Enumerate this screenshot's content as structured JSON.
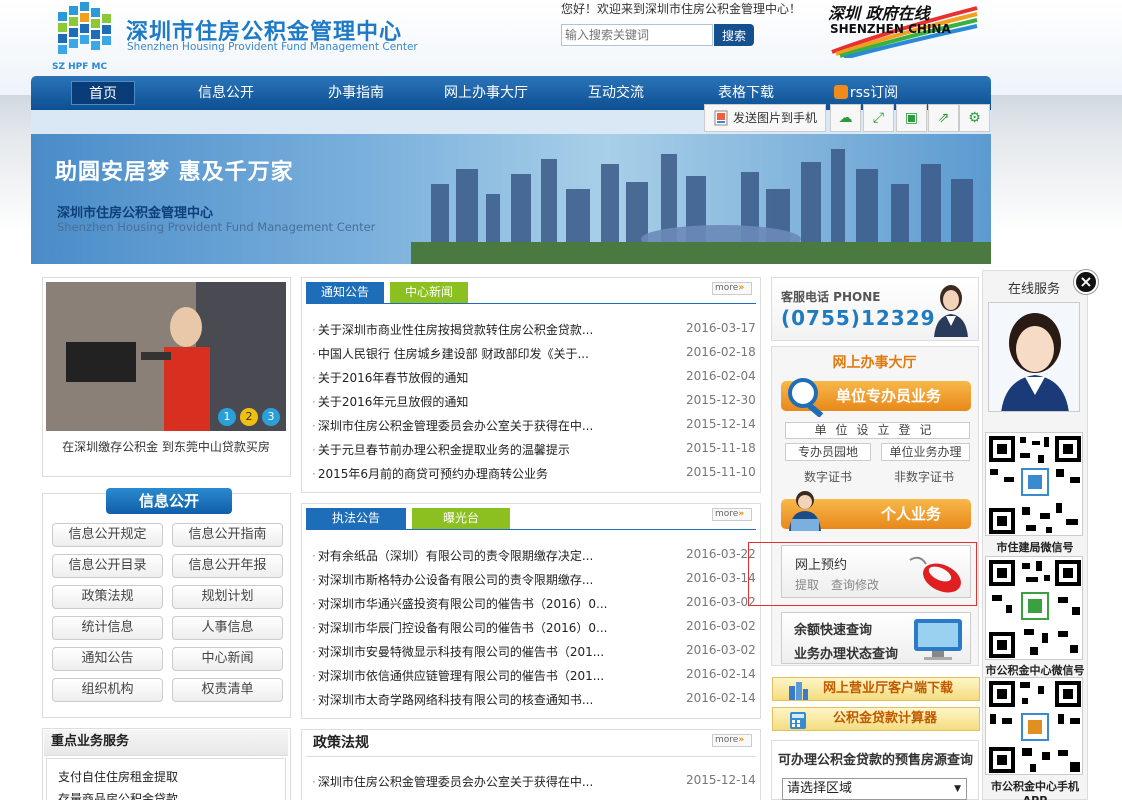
{
  "header": {
    "logo_cn": "深圳市住房公积金管理中心",
    "logo_en": "Shenzhen Housing Provident Fund Management Center",
    "logo_abbr": "SZ HPF MC",
    "welcome": "您好！欢迎来到深圳市住房公积金管理中心！",
    "search_placeholder": "输入搜索关键词",
    "search_button": "搜索",
    "gov_logo_cn": "深圳 政府在线",
    "gov_logo_en": "SHENZHEN CHINA"
  },
  "nav": {
    "items": [
      "首页",
      "信息公开",
      "办事指南",
      "网上办事大厅",
      "互动交流",
      "表格下载",
      "rss订阅"
    ]
  },
  "toolbar": {
    "send_label": "发送图片到手机",
    "icons": [
      "cloud-icon",
      "fullscreen-icon",
      "save-icon",
      "share-icon",
      "settings-icon"
    ]
  },
  "banner": {
    "slogan": "助圆安居梦 惠及千万家",
    "org_cn": "深圳市住房公积金管理中心",
    "org_en": "Shenzhen Housing Provident Fund Management Center"
  },
  "slideshow": {
    "caption": "在深圳缴存公积金 到东莞中山贷款买房",
    "dots": [
      "1",
      "2",
      "3"
    ]
  },
  "info_open": {
    "title": "信息公开",
    "buttons": [
      "信息公开规定",
      "信息公开指南",
      "信息公开目录",
      "信息公开年报",
      "政策法规",
      "规划计划",
      "统计信息",
      "人事信息",
      "通知公告",
      "中心新闻",
      "组织机构",
      "权责清单"
    ]
  },
  "key_services": {
    "title": "重点业务服务",
    "items": [
      "支付自住住房租金提取",
      "存量商品房公积金贷款"
    ]
  },
  "news1": {
    "tabs": [
      "通知公告",
      "中心新闻"
    ],
    "more": "more",
    "items": [
      {
        "title": "关于深圳市商业性住房按揭贷款转住房公积金贷款...",
        "date": "2016-03-17"
      },
      {
        "title": "中国人民银行 住房城乡建设部 财政部印发《关于...",
        "date": "2016-02-18"
      },
      {
        "title": "关于2016年春节放假的通知",
        "date": "2016-02-04"
      },
      {
        "title": "关于2016年元旦放假的通知",
        "date": "2015-12-30"
      },
      {
        "title": "深圳市住房公积金管理委员会办公室关于获得在中...",
        "date": "2015-12-14"
      },
      {
        "title": "关于元旦春节前办理公积金提取业务的温馨提示",
        "date": "2015-11-18"
      },
      {
        "title": "2015年6月前的商贷可预约办理商转公业务",
        "date": "2015-11-10"
      }
    ]
  },
  "news2": {
    "tabs": [
      "执法公告",
      "曝光台"
    ],
    "more": "more",
    "items": [
      {
        "title": "对有余纸品（深圳）有限公司的责令限期缴存决定...",
        "date": "2016-03-22"
      },
      {
        "title": "对深圳市斯格特办公设备有限公司的责令限期缴存...",
        "date": "2016-03-14"
      },
      {
        "title": "对深圳市华通兴盛投资有限公司的催告书（2016）0...",
        "date": "2016-03-02"
      },
      {
        "title": "对深圳市华辰门控设备有限公司的催告书（2016）0...",
        "date": "2016-03-02"
      },
      {
        "title": "对深圳市安曼特微显示科技有限公司的催告书（201...",
        "date": "2016-03-02"
      },
      {
        "title": "对深圳市依信通供应链管理有限公司的催告书（201...",
        "date": "2016-02-14"
      },
      {
        "title": "对深圳市太奇学路网络科技有限公司的核查通知书...",
        "date": "2016-02-14"
      }
    ]
  },
  "policy": {
    "title": "政策法规",
    "more": "more",
    "items": [
      {
        "title": "深圳市住房公积金管理委员会办公室关于获得在中...",
        "date": "2015-12-14"
      }
    ]
  },
  "hotline": {
    "label": "客服电话 PHONE",
    "number": "(0755)12329"
  },
  "online_hall": {
    "title": "网上办事大厅",
    "unit_button": "单位专办员业务",
    "unit_register": "单位设立登记",
    "tab_admin": "专办员园地",
    "tab_business": "单位业务办理",
    "cert_digital": "数字证书",
    "cert_nondigital": "非数字证书",
    "personal_button": "个人业务",
    "appointment_title": "网上预约",
    "appointment_withdraw": "提取",
    "appointment_query": "查询修改",
    "query_balance": "余额快速查询",
    "query_status": "业务办理状态查询",
    "client_download": "网上营业厅客户端下载",
    "loan_calculator": "公积金贷款计算器",
    "presale_title": "可办理公积金贷款的预售房源查询",
    "region_select": "请选择区域"
  },
  "side": {
    "title": "在线服务",
    "qr_labels": [
      "市住建局微信号",
      "市公积金中心微信号",
      "市公积金中心手机APP"
    ]
  }
}
